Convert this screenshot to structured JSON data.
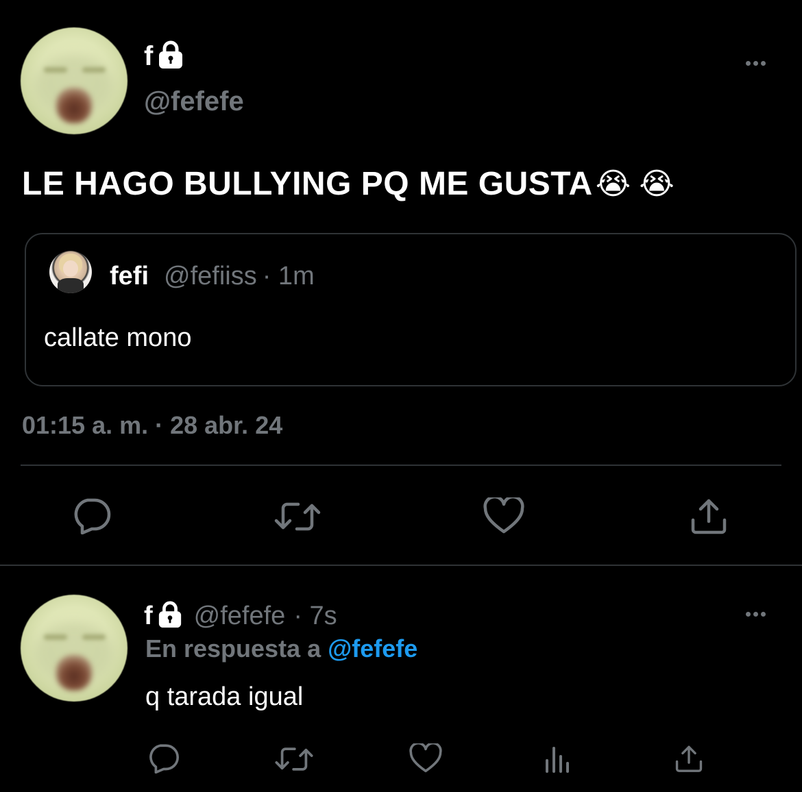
{
  "main_tweet": {
    "display_name": "f",
    "handle": "@fefefe",
    "text": "LE HAGO BULLYING PQ ME GUSTA",
    "emojis": "😭 😭",
    "timestamp": "01:15 a. m. · 28 abr. 24"
  },
  "quoted_tweet": {
    "display_name": "fefi",
    "handle": "@fefiiss",
    "time": "· 1m",
    "text": "callate mono"
  },
  "reply": {
    "display_name": "f",
    "handle": "@fefefe",
    "time": "· 7s",
    "replying_to_prefix": "En respuesta a",
    "replying_to_handle": "@fefefe",
    "text": "q tarada igual"
  },
  "icons": {
    "lock": "lock-icon",
    "more": "more-options-icon",
    "reply": "reply-icon",
    "retweet": "retweet-icon",
    "like": "like-icon",
    "share": "share-icon",
    "analytics": "analytics-icon"
  },
  "colors": {
    "background": "#000000",
    "text_primary": "#ffffff",
    "text_secondary": "#71767b",
    "border": "#2f3336",
    "accent": "#1d9bf0"
  }
}
